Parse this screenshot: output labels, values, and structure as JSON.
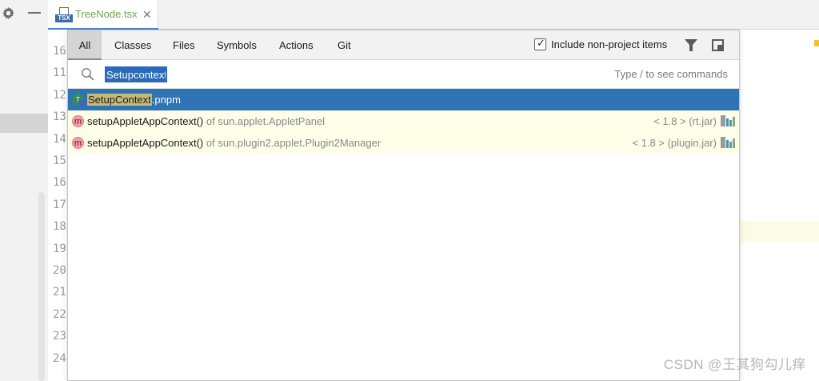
{
  "editor": {
    "tab_title": "TreeNode.tsx",
    "tab_icon_label": "TSX",
    "close_glyph": "✕",
    "line_numbers": [
      "16",
      "11",
      "12",
      "13",
      "14",
      "15",
      "16",
      "17",
      "18",
      "19",
      "20",
      "21",
      "22",
      "23",
      "24"
    ]
  },
  "popup": {
    "tabs": [
      "All",
      "Classes",
      "Files",
      "Symbols",
      "Actions",
      "Git"
    ],
    "active_tab": "All",
    "include_label": "Include non-project items",
    "include_checked": true,
    "search_value": "Setupcontext",
    "search_hint": "Type / to see commands",
    "results": [
      {
        "icon": "ts-file-icon",
        "badge": "T",
        "match": "SetupContext",
        "name": "",
        "suffix": ".pnpm",
        "context": "",
        "info": ""
      },
      {
        "icon": "method-icon",
        "badge": "m",
        "match": "",
        "name": "setupAppletAppContext()",
        "suffix": "",
        "context": "of sun.applet.AppletPanel",
        "info": "< 1.8 > (rt.jar)"
      },
      {
        "icon": "method-icon",
        "badge": "m",
        "match": "",
        "name": "setupAppletAppContext()",
        "suffix": "",
        "context": "of sun.plugin2.applet.Plugin2Manager",
        "info": "< 1.8 > (plugin.jar)"
      }
    ]
  },
  "watermark": "CSDN @王其狗勾儿痒",
  "colors": {
    "selection": "#2e74b5",
    "tab_title": "#6aa84f",
    "row_highlight": "#fdfde8"
  }
}
